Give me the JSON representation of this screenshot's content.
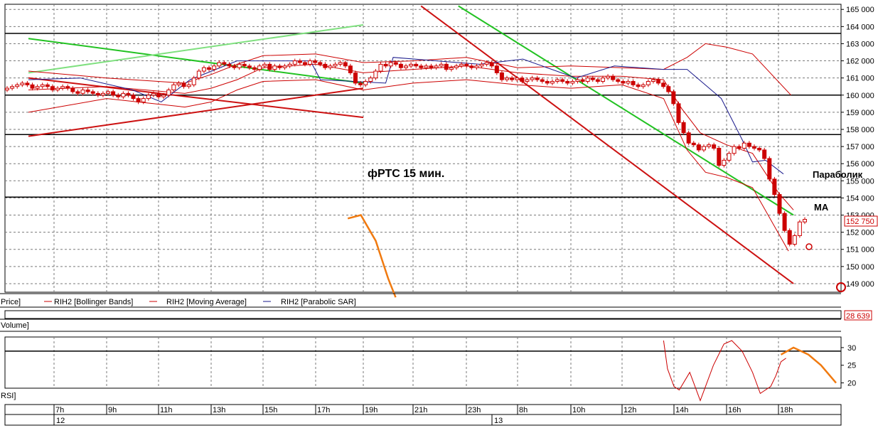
{
  "colors": {
    "candle_up": "#cc0000",
    "candle_down": "#cc0000",
    "bollinger": "#cc0000",
    "moving_average": "#cc0000",
    "parabolic_sar": "#1a1a8c",
    "trend_green": "#22c222",
    "trend_light_green": "#7fe07f",
    "trend_red": "#cc1111",
    "forecast": "#f07a10",
    "grid": "#7a7a7a",
    "level": "#000000"
  },
  "annotations": {
    "title": "фРТС  15  мин.",
    "parabolic_label": "Параболик",
    "ma_label": "МА"
  },
  "legend": {
    "price": "Price]",
    "bollinger": "RIH2 [Bollinger Bands]",
    "moving_average": "RIH2 [Moving Average]",
    "parabolic_sar": "RIH2 [Parabolic SAR]"
  },
  "volume_panel": {
    "label": "Volume]",
    "last_value": "28 639"
  },
  "rsi_panel": {
    "label": "RSI]",
    "ticks": [
      "30",
      "25",
      "20"
    ]
  },
  "price_axis": {
    "last_price": "152 750"
  },
  "time_axis": {
    "hours": [
      "7h",
      "9h",
      "11h",
      "13h",
      "15h",
      "17h",
      "19h",
      "21h",
      "23h",
      "8h",
      "10h",
      "12h",
      "14h",
      "16h",
      "18h"
    ],
    "dates": [
      "12",
      "13"
    ]
  },
  "chart_data": {
    "type": "candlestick",
    "title": "фРТС  15  мин.",
    "instrument": "RIH2",
    "y_axis": {
      "ylim": [
        148500,
        165300
      ],
      "ticks": [
        165000,
        164000,
        163000,
        162000,
        161000,
        160000,
        159000,
        158000,
        157000,
        156000,
        155000,
        154000,
        153000,
        152000,
        151000,
        150000,
        149000
      ],
      "tick_labels": [
        "165 000",
        "164 000",
        "163 000",
        "162 000",
        "161 000",
        "160 000",
        "159 000",
        "158 000",
        "157 000",
        "156 000",
        "155 000",
        "154 000",
        "153 000",
        "152 000",
        "151 000",
        "150 000",
        "149 000"
      ]
    },
    "horizontal_levels": [
      163600,
      160000,
      157700,
      154050
    ],
    "candles_o": [
      160300,
      160400,
      160500,
      160600,
      160700,
      160600,
      160400,
      160500,
      160600,
      160500,
      160300,
      160400,
      160500,
      160400,
      160200,
      160100,
      160300,
      160200,
      160100,
      160000,
      160100,
      160200,
      160000,
      159900,
      160100,
      160000,
      159800,
      159600,
      159800,
      160000,
      160100,
      159900,
      160000,
      160300,
      160600,
      160700,
      160500,
      160600,
      161000,
      161400,
      161600,
      161500,
      161700,
      161900,
      161800,
      161700,
      161600,
      161800,
      161700,
      161600,
      161500,
      161700,
      161800,
      161500,
      161700,
      161600,
      161700,
      161800,
      162000,
      161900,
      161800,
      162000,
      161900,
      161800,
      161600,
      161700,
      161800,
      161900,
      161700,
      161300,
      160700,
      160600,
      160800,
      161000,
      161400,
      161800,
      161700,
      161900,
      161800,
      161600,
      161700,
      161800,
      161700,
      161600,
      161700,
      161600,
      161700,
      161800,
      161500,
      161600,
      161700,
      161800,
      161700,
      161600,
      161700,
      161800,
      161900,
      161700,
      161300,
      160900,
      161000,
      160900,
      161000,
      160800,
      160900,
      161000,
      160900,
      160800,
      160700,
      160800,
      160900,
      160800,
      160700,
      160800,
      160900,
      160800,
      161000,
      160900,
      160800,
      161000,
      161100,
      160900,
      160800,
      160700,
      160800,
      160600,
      160500,
      160600,
      160800,
      160900,
      160700,
      160500,
      160200,
      159500,
      158400,
      157800,
      157200,
      157100,
      156800,
      157000,
      157100,
      156900,
      155900,
      156200,
      156600,
      157000,
      156900,
      157200,
      157000,
      156900,
      156800,
      156300,
      155100,
      154200,
      153100,
      152100,
      151300,
      151800,
      152600
    ],
    "candles_c": [
      160400,
      160500,
      160600,
      160700,
      160600,
      160400,
      160500,
      160600,
      160500,
      160300,
      160400,
      160500,
      160400,
      160200,
      160100,
      160300,
      160200,
      160100,
      160000,
      160100,
      160200,
      160000,
      159900,
      160100,
      160000,
      159800,
      159600,
      159800,
      160000,
      160100,
      159900,
      160000,
      160300,
      160600,
      160700,
      160500,
      160600,
      161000,
      161400,
      161600,
      161500,
      161700,
      161900,
      161800,
      161700,
      161600,
      161800,
      161700,
      161600,
      161500,
      161700,
      161800,
      161500,
      161700,
      161600,
      161700,
      161800,
      162000,
      161900,
      161800,
      162000,
      161900,
      161800,
      161600,
      161700,
      161800,
      161900,
      161700,
      161300,
      160700,
      160600,
      160800,
      161000,
      161400,
      161800,
      161700,
      161900,
      161800,
      161600,
      161700,
      161800,
      161700,
      161600,
      161700,
      161600,
      161700,
      161800,
      161500,
      161600,
      161700,
      161800,
      161700,
      161600,
      161700,
      161800,
      161900,
      161700,
      161300,
      160900,
      161000,
      160900,
      161000,
      160800,
      160900,
      161000,
      160900,
      160800,
      160700,
      160800,
      160900,
      160800,
      160700,
      160800,
      160900,
      160800,
      161000,
      160900,
      160800,
      161000,
      161100,
      160900,
      160800,
      160700,
      160800,
      160600,
      160500,
      160600,
      160800,
      160900,
      160700,
      160500,
      160200,
      159500,
      158400,
      157800,
      157200,
      157100,
      156800,
      157000,
      157100,
      156900,
      155900,
      156200,
      156600,
      157000,
      156900,
      157200,
      157000,
      156900,
      156800,
      156300,
      155100,
      154200,
      153100,
      152100,
      151300,
      151800,
      152600,
      152750
    ],
    "candles_x_start_hour": 6.0,
    "candles_step_hours": 0.25,
    "bollinger_upper": [
      [
        6,
        161400
      ],
      [
        9,
        161000
      ],
      [
        12,
        160700
      ],
      [
        13,
        161200
      ],
      [
        14,
        161800
      ],
      [
        15,
        162300
      ],
      [
        17,
        162400
      ],
      [
        19,
        161900
      ],
      [
        21,
        162000
      ],
      [
        23,
        162200
      ],
      [
        8,
        161600
      ],
      [
        10,
        161700
      ],
      [
        12,
        161600
      ],
      [
        13.6,
        161500
      ],
      [
        14.5,
        162200
      ],
      [
        15.2,
        163000
      ],
      [
        16,
        162800
      ],
      [
        17,
        162400
      ],
      [
        18.5,
        160000
      ]
    ],
    "bollinger_lower": [
      [
        6,
        159000
      ],
      [
        9,
        159800
      ],
      [
        12,
        159300
      ],
      [
        13,
        159600
      ],
      [
        14,
        160300
      ],
      [
        15,
        160800
      ],
      [
        17,
        160900
      ],
      [
        19,
        160300
      ],
      [
        21,
        160700
      ],
      [
        23,
        160900
      ],
      [
        8,
        160600
      ],
      [
        10,
        160400
      ],
      [
        12,
        160600
      ],
      [
        13.6,
        159800
      ],
      [
        14.5,
        156800
      ],
      [
        15.2,
        155500
      ],
      [
        16,
        155200
      ],
      [
        17,
        154600
      ],
      [
        18.4,
        150900
      ]
    ],
    "moving_average": [
      [
        6,
        160300
      ],
      [
        9,
        160500
      ],
      [
        12,
        160100
      ],
      [
        13,
        160400
      ],
      [
        14,
        160900
      ],
      [
        15,
        161600
      ],
      [
        17,
        161800
      ],
      [
        19,
        161300
      ],
      [
        21,
        161500
      ],
      [
        23,
        161700
      ],
      [
        8,
        161300
      ],
      [
        10,
        161100
      ],
      [
        12,
        161100
      ],
      [
        13.6,
        160900
      ],
      [
        14.3,
        159200
      ],
      [
        15,
        157800
      ],
      [
        16,
        157100
      ],
      [
        17,
        156600
      ],
      [
        18,
        154300
      ],
      [
        18.6,
        153300
      ]
    ],
    "parabolic_sar": [
      [
        6,
        160900
      ],
      [
        8,
        161000
      ],
      [
        10,
        160300
      ],
      [
        11.1,
        159600
      ],
      [
        12.2,
        160900
      ],
      [
        14,
        162000
      ],
      [
        16.8,
        162000
      ],
      [
        17.2,
        160900
      ],
      [
        19.9,
        160700
      ],
      [
        20.2,
        162200
      ],
      [
        23.6,
        161800
      ],
      [
        8.2,
        162100
      ],
      [
        10.2,
        161000
      ],
      [
        11.7,
        161700
      ],
      [
        13.6,
        161500
      ],
      [
        14.5,
        161500
      ],
      [
        15.8,
        159800
      ],
      [
        16.6,
        157400
      ],
      [
        17,
        156100
      ],
      [
        17.5,
        156200
      ],
      [
        18.2,
        155400
      ]
    ],
    "trend_lines": [
      {
        "color": "green",
        "from": [
          6,
          163300
        ],
        "to": [
          19,
          160700
        ]
      },
      {
        "color": "light_green",
        "from": [
          6,
          161300
        ],
        "to": [
          19,
          164100
        ]
      },
      {
        "color": "green",
        "from": [
          22.7,
          165200
        ],
        "to": [
          18.6,
          153000
        ]
      },
      {
        "color": "red",
        "from": [
          6,
          161000
        ],
        "to": [
          19,
          158700
        ]
      },
      {
        "color": "red",
        "from": [
          6,
          157600
        ],
        "to": [
          19,
          160400
        ]
      },
      {
        "color": "red",
        "from": [
          21.3,
          165200
        ],
        "to": [
          18.6,
          149000
        ]
      }
    ],
    "forecast_curve": [
      [
        18.35,
        152800
      ],
      [
        18.9,
        153000
      ],
      [
        19.5,
        151500
      ],
      [
        20,
        149300
      ],
      [
        20.3,
        148200
      ]
    ],
    "rsi": {
      "ylim": [
        18.5,
        33
      ],
      "ticks": [
        30,
        25,
        20
      ],
      "level": 29,
      "values": [
        [
          13.6,
          32
        ],
        [
          13.75,
          24
        ],
        [
          14,
          19
        ],
        [
          14.2,
          18
        ],
        [
          14.6,
          23
        ],
        [
          15,
          15
        ],
        [
          15.5,
          25
        ],
        [
          15.9,
          31
        ],
        [
          16.2,
          32
        ],
        [
          16.6,
          29
        ],
        [
          17,
          23
        ],
        [
          17.3,
          17
        ],
        [
          17.7,
          19
        ],
        [
          17.9,
          22
        ],
        [
          18.1,
          26
        ],
        [
          18.3,
          27
        ]
      ],
      "forecast": [
        [
          18.1,
          28
        ],
        [
          18.6,
          30
        ],
        [
          19.2,
          28
        ],
        [
          19.7,
          25
        ],
        [
          20.3,
          20
        ]
      ]
    }
  }
}
